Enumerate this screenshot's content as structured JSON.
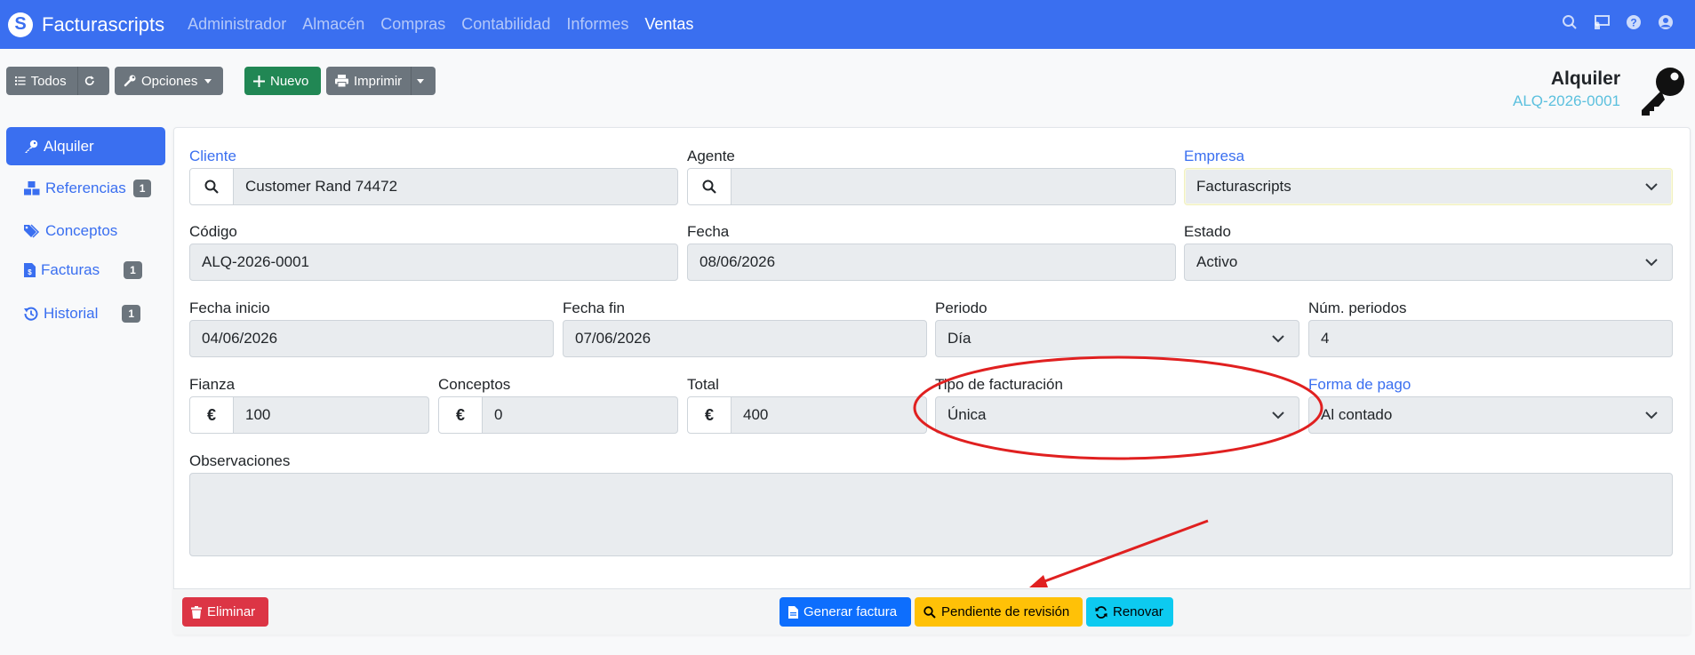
{
  "app": {
    "name": "Facturascripts"
  },
  "menu": [
    "Administrador",
    "Almacén",
    "Compras",
    "Contabilidad",
    "Informes",
    "Ventas"
  ],
  "toolbar": {
    "todos": "Todos",
    "opciones": "Opciones",
    "nuevo": "Nuevo",
    "imprimir": "Imprimir"
  },
  "header": {
    "title": "Alquiler",
    "code": "ALQ-2026-0001"
  },
  "sidebar": {
    "items": [
      {
        "label": "Alquiler",
        "badge": ""
      },
      {
        "label": "Referencias",
        "badge": "1"
      },
      {
        "label": "Conceptos",
        "badge": ""
      },
      {
        "label": "Facturas",
        "badge": "1"
      },
      {
        "label": "Historial",
        "badge": "1"
      }
    ]
  },
  "form": {
    "cliente": {
      "label": "Cliente",
      "value": "Customer Rand 74472"
    },
    "agente": {
      "label": "Agente",
      "value": ""
    },
    "empresa": {
      "label": "Empresa",
      "value": "Facturascripts"
    },
    "codigo": {
      "label": "Código",
      "value": "ALQ-2026-0001"
    },
    "fecha": {
      "label": "Fecha",
      "value": "08/06/2026"
    },
    "estado": {
      "label": "Estado",
      "value": "Activo"
    },
    "fecha_inicio": {
      "label": "Fecha inicio",
      "value": "04/06/2026"
    },
    "fecha_fin": {
      "label": "Fecha fin",
      "value": "07/06/2026"
    },
    "periodo": {
      "label": "Periodo",
      "value": "Día"
    },
    "num_periodos": {
      "label": "Núm. periodos",
      "value": "4"
    },
    "fianza": {
      "label": "Fianza",
      "value": "100",
      "currency": "€"
    },
    "conceptos": {
      "label": "Conceptos",
      "value": "0",
      "currency": "€"
    },
    "total": {
      "label": "Total",
      "value": "400",
      "currency": "€"
    },
    "tipo_facturacion": {
      "label": "Tipo de facturación",
      "value": "Única"
    },
    "forma_pago": {
      "label": "Forma de pago",
      "value": "Al contado"
    },
    "observaciones": {
      "label": "Observaciones",
      "value": ""
    }
  },
  "footer": {
    "eliminar": "Eliminar",
    "generar": "Generar factura",
    "pendiente": "Pendiente de revisión",
    "renovar": "Renovar"
  },
  "colors": {
    "navbar": "#3a6ff0",
    "annotation": "#e02020"
  }
}
